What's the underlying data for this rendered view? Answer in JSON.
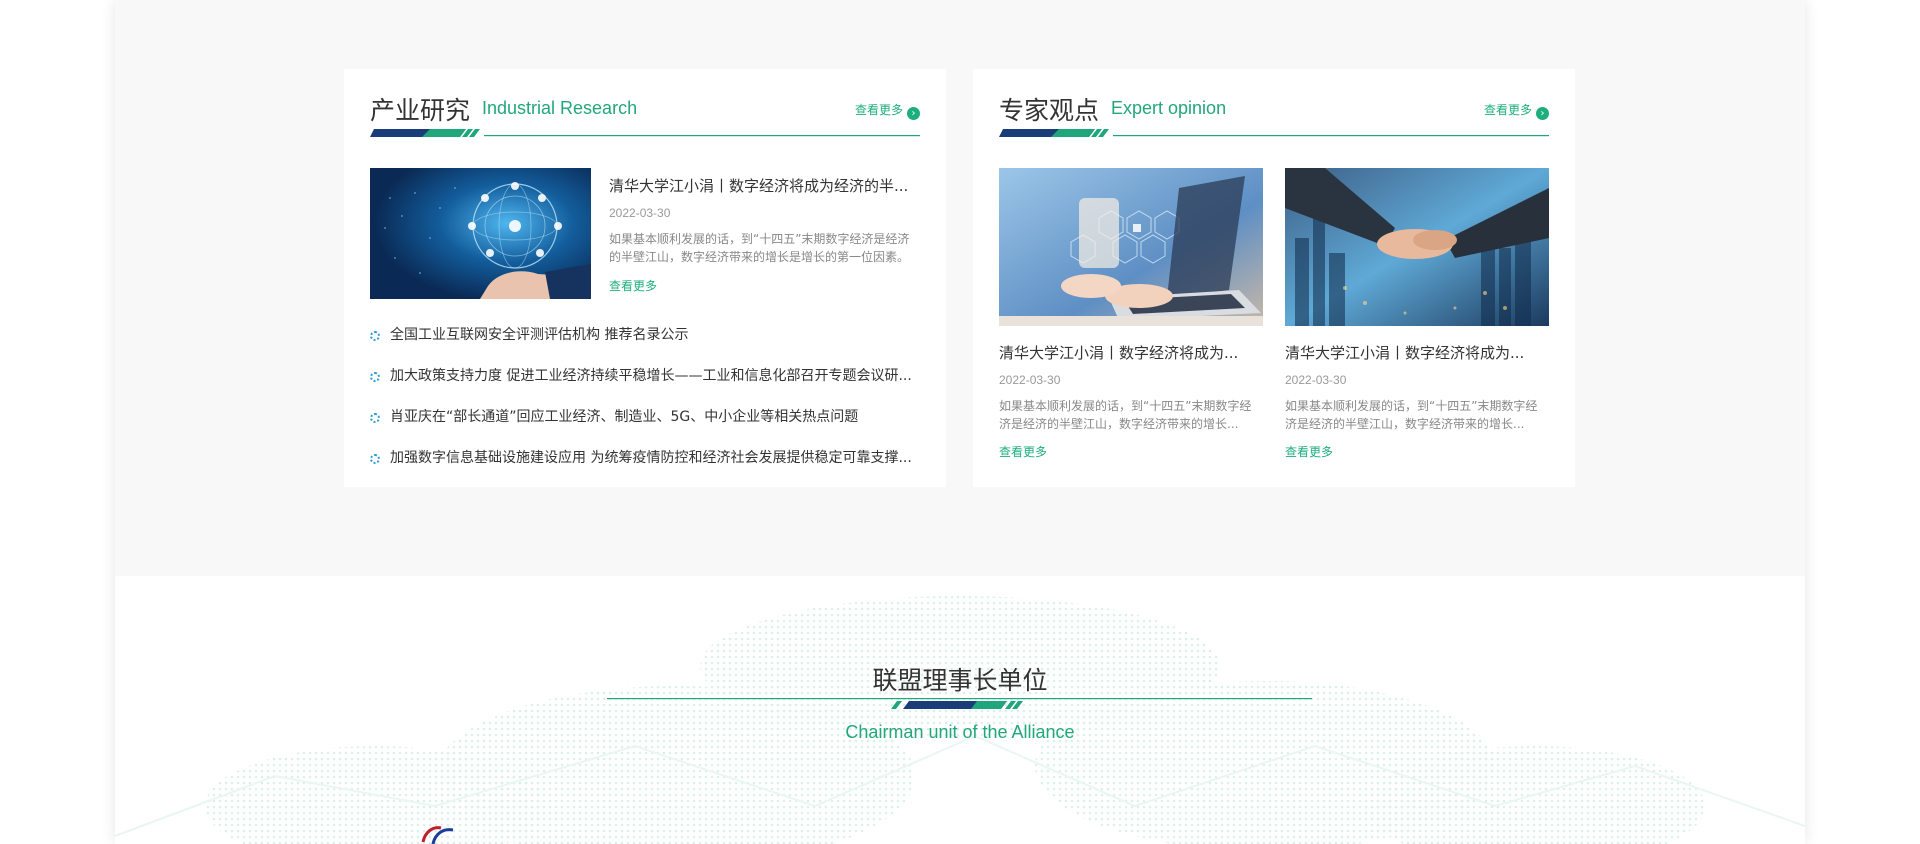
{
  "industrial": {
    "title_cn": "产业研究",
    "title_en": "Industrial Research",
    "more": "查看更多",
    "feature": {
      "title": "清华大学江小涓丨数字经济将成为经济的半...",
      "date": "2022-03-30",
      "desc": "如果基本顺利发展的话，到“十四五”末期数字经济是经济的半壁江山，数字经济带来的增长是增长的第一位因素。",
      "more": "查看更多"
    },
    "news": [
      "全国工业互联网安全评测评估机构 推荐名录公示",
      "加大政策支持力度 促进工业经济持续平稳增长——工业和信息化部召开专题会议研...",
      "肖亚庆在“部长通道”回应工业经济、制造业、5G、中小企业等相关热点问题",
      "加强数字信息基础设施建设应用 为统筹疫情防控和经济社会发展提供稳定可靠支撑..."
    ]
  },
  "expert": {
    "title_cn": "专家观点",
    "title_en": "Expert opinion",
    "more": "查看更多",
    "cards": [
      {
        "title": "清华大学江小涓丨数字经济将成为...",
        "date": "2022-03-30",
        "desc": "如果基本顺利发展的话，到“十四五”末期数字经济是经济的半壁江山，数字经济带来的增长...",
        "more": "查看更多"
      },
      {
        "title": "清华大学江小涓丨数字经济将成为...",
        "date": "2022-03-30",
        "desc": "如果基本顺利发展的话，到“十四五”末期数字经济是经济的半壁江山，数字经济带来的增长...",
        "more": "查看更多"
      }
    ]
  },
  "alliance": {
    "title": "联盟理事长单位",
    "subtitle": "Chairman unit of the Alliance"
  },
  "colors": {
    "accent_green": "#1eae7e",
    "navy": "#1a3d7a",
    "page_bg": "#f8f8f8"
  }
}
